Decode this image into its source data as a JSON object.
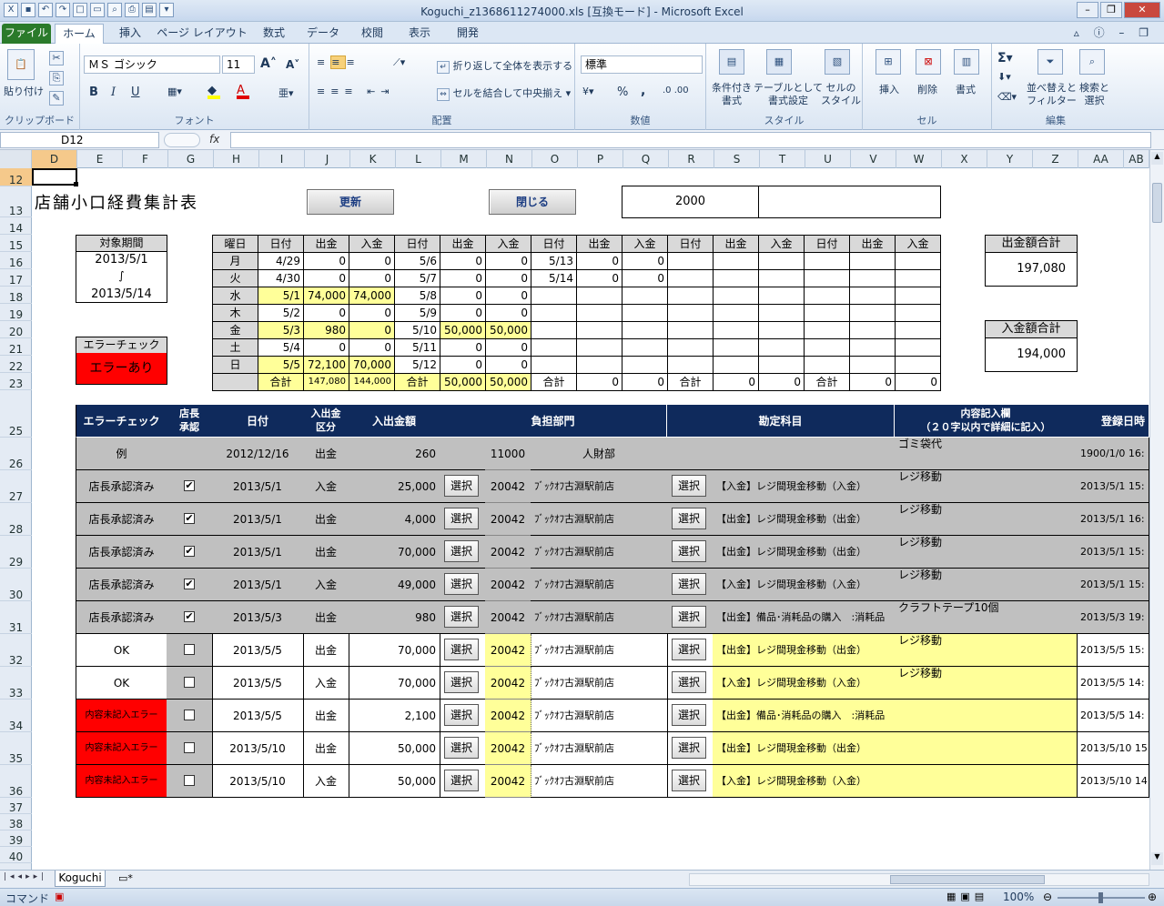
{
  "window": {
    "title": "Koguchi_z1368611274000.xls [互換モード] - Microsoft Excel"
  },
  "tabs": [
    "ファイル",
    "ホーム",
    "挿入",
    "ページ レイアウト",
    "数式",
    "データ",
    "校閲",
    "表示",
    "開発"
  ],
  "ribbon": {
    "clipboard": {
      "paste": "貼り付け",
      "label": "クリップボード"
    },
    "font": {
      "name": "ＭＳ ゴシック",
      "size": "11",
      "label": "フォント",
      "bold": "B",
      "italic": "I",
      "underline": "U"
    },
    "align": {
      "wrap": "折り返して全体を表示する",
      "merge": "セルを結合して中央揃え",
      "label": "配置"
    },
    "number": {
      "format": "標準",
      "label": "数値",
      "percent": "%",
      "comma": ","
    },
    "styles": {
      "cond": "条件付き\n書式",
      "table": "テーブルとして\n書式設定",
      "cell": "セルの\nスタイル",
      "label": "スタイル"
    },
    "cells": {
      "insert": "挿入",
      "delete": "削除",
      "format": "書式",
      "label": "セル"
    },
    "edit": {
      "sort": "並べ替えと\nフィルター",
      "find": "検索と\n選択",
      "label": "編集"
    }
  },
  "formula": {
    "namebox": "D12",
    "fx": "fx"
  },
  "columns": [
    "D",
    "E",
    "F",
    "G",
    "H",
    "I",
    "J",
    "K",
    "L",
    "M",
    "N",
    "O",
    "P",
    "Q",
    "R",
    "S",
    "T",
    "U",
    "V",
    "W",
    "X",
    "Y",
    "Z",
    "AA",
    "AB"
  ],
  "rows": [
    "12",
    "13",
    "14",
    "15",
    "16",
    "17",
    "18",
    "19",
    "20",
    "21",
    "22",
    "23",
    "25",
    "26",
    "27",
    "28",
    "29",
    "30",
    "31",
    "32",
    "33",
    "34",
    "35",
    "36",
    "37",
    "38",
    "39",
    "40"
  ],
  "sheet": {
    "title": "店舗小口経費集計表",
    "refresh": "更新",
    "close": "閉じる",
    "code": "2000",
    "period_label": "対象期間",
    "period_from": "2013/5/1",
    "period_sep": "∫",
    "period_to": "2013/5/14",
    "error_label": "エラーチェック",
    "error_value": "エラーあり",
    "out_total_label": "出金額合計",
    "out_total": "197,080",
    "in_total_label": "入金額合計",
    "in_total": "194,000",
    "week": {
      "head": [
        "曜日",
        "日付",
        "出金",
        "入金",
        "日付",
        "出金",
        "入金",
        "日付",
        "出金",
        "入金",
        "日付",
        "出金",
        "入金",
        "日付",
        "出金",
        "入金"
      ],
      "rows": [
        [
          "月",
          "4/29",
          "0",
          "0",
          "5/6",
          "0",
          "0",
          "5/13",
          "0",
          "0",
          "",
          "",
          "",
          "",
          "",
          ""
        ],
        [
          "火",
          "4/30",
          "0",
          "0",
          "5/7",
          "0",
          "0",
          "5/14",
          "0",
          "0",
          "",
          "",
          "",
          "",
          "",
          ""
        ],
        [
          "水",
          "5/1",
          "74,000",
          "74,000",
          "5/8",
          "0",
          "0",
          "",
          "",
          "",
          "",
          "",
          "",
          "",
          "",
          ""
        ],
        [
          "木",
          "5/2",
          "0",
          "0",
          "5/9",
          "0",
          "0",
          "",
          "",
          "",
          "",
          "",
          "",
          "",
          "",
          ""
        ],
        [
          "金",
          "5/3",
          "980",
          "0",
          "5/10",
          "50,000",
          "50,000",
          "",
          "",
          "",
          "",
          "",
          "",
          "",
          "",
          ""
        ],
        [
          "土",
          "5/4",
          "0",
          "0",
          "5/11",
          "0",
          "0",
          "",
          "",
          "",
          "",
          "",
          "",
          "",
          "",
          ""
        ],
        [
          "日",
          "5/5",
          "72,100",
          "70,000",
          "5/12",
          "0",
          "0",
          "",
          "",
          "",
          "",
          "",
          "",
          "",
          "",
          ""
        ]
      ],
      "total": [
        "",
        "合計",
        "147,080",
        "144,000",
        "合計",
        "50,000",
        "50,000",
        "合計",
        "0",
        "0",
        "合計",
        "0",
        "0",
        "合計",
        "0",
        "0"
      ]
    },
    "list": {
      "head": {
        "err": "エラーチェック",
        "approve": "店長\n承認",
        "date": "日付",
        "kind": "入出金\n区分",
        "amount": "入出金額",
        "dept": "負担部門",
        "acct": "勘定科目",
        "memo": "内容記入欄\n（２０字以内で詳細に記入）",
        "reg": "登録日時"
      },
      "example": {
        "err": "例",
        "date": "2012/12/16",
        "kind": "出金",
        "amount": "260",
        "code": "11000",
        "dept": "人財部",
        "memo": "ゴミ袋代",
        "reg": "1900/1/0 16:"
      },
      "select": "選択",
      "rows": [
        {
          "err": "店長承認済み",
          "chk": "✔",
          "date": "2013/5/1",
          "kind": "入金",
          "amount": "25,000",
          "code": "20042",
          "dept": "ﾌﾞｯｸｵﾌ古淵駅前店",
          "acct": "【入金】レジ間現金移動（入金）",
          "memo": "レジ移動",
          "reg": "2013/5/1 15:"
        },
        {
          "err": "店長承認済み",
          "chk": "✔",
          "date": "2013/5/1",
          "kind": "出金",
          "amount": "4,000",
          "code": "20042",
          "dept": "ﾌﾞｯｸｵﾌ古淵駅前店",
          "acct": "【出金】レジ間現金移動（出金）",
          "memo": "レジ移動",
          "reg": "2013/5/1 16:"
        },
        {
          "err": "店長承認済み",
          "chk": "✔",
          "date": "2013/5/1",
          "kind": "出金",
          "amount": "70,000",
          "code": "20042",
          "dept": "ﾌﾞｯｸｵﾌ古淵駅前店",
          "acct": "【出金】レジ間現金移動（出金）",
          "memo": "レジ移動",
          "reg": "2013/5/1 15:"
        },
        {
          "err": "店長承認済み",
          "chk": "✔",
          "date": "2013/5/1",
          "kind": "入金",
          "amount": "49,000",
          "code": "20042",
          "dept": "ﾌﾞｯｸｵﾌ古淵駅前店",
          "acct": "【入金】レジ間現金移動（入金）",
          "memo": "レジ移動",
          "reg": "2013/5/1 15:"
        },
        {
          "err": "店長承認済み",
          "chk": "✔",
          "date": "2013/5/3",
          "kind": "出金",
          "amount": "980",
          "code": "20042",
          "dept": "ﾌﾞｯｸｵﾌ古淵駅前店",
          "acct": "【出金】備品･消耗品の購入　:消耗品",
          "memo": "クラフトテープ10個",
          "reg": "2013/5/3 19:"
        },
        {
          "err": "OK",
          "chk": "",
          "date": "2013/5/5",
          "kind": "出金",
          "amount": "70,000",
          "code": "20042",
          "dept": "ﾌﾞｯｸｵﾌ古淵駅前店",
          "acct": "【出金】レジ間現金移動（出金）",
          "memo": "レジ移動",
          "reg": "2013/5/5 15:"
        },
        {
          "err": "OK",
          "chk": "",
          "date": "2013/5/5",
          "kind": "入金",
          "amount": "70,000",
          "code": "20042",
          "dept": "ﾌﾞｯｸｵﾌ古淵駅前店",
          "acct": "【入金】レジ間現金移動（入金）",
          "memo": "レジ移動",
          "reg": "2013/5/5 14:"
        },
        {
          "err": "内容未記入エラー",
          "chk": "",
          "date": "2013/5/5",
          "kind": "出金",
          "amount": "2,100",
          "code": "20042",
          "dept": "ﾌﾞｯｸｵﾌ古淵駅前店",
          "acct": "【出金】備品･消耗品の購入　:消耗品",
          "memo": "",
          "reg": "2013/5/5 14:"
        },
        {
          "err": "内容未記入エラー",
          "chk": "",
          "date": "2013/5/10",
          "kind": "出金",
          "amount": "50,000",
          "code": "20042",
          "dept": "ﾌﾞｯｸｵﾌ古淵駅前店",
          "acct": "【出金】レジ間現金移動（出金）",
          "memo": "",
          "reg": "2013/5/10 15"
        },
        {
          "err": "内容未記入エラー",
          "chk": "",
          "date": "2013/5/10",
          "kind": "入金",
          "amount": "50,000",
          "code": "20042",
          "dept": "ﾌﾞｯｸｵﾌ古淵駅前店",
          "acct": "【入金】レジ間現金移動（入金）",
          "memo": "",
          "reg": "2013/5/10 14"
        }
      ]
    }
  },
  "sheet_tab": "Koguchi",
  "status": {
    "mode": "コマンド",
    "zoom": "100%"
  }
}
